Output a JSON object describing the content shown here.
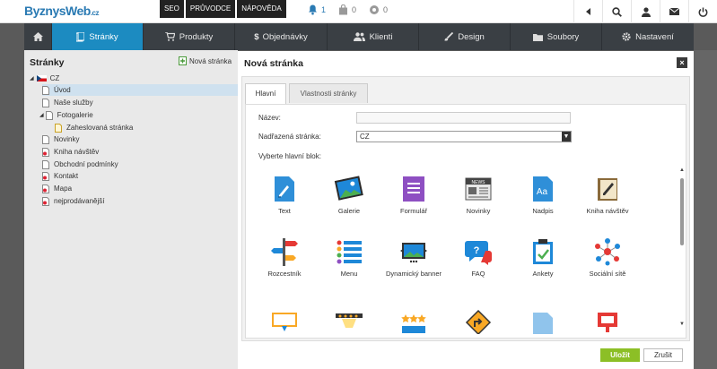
{
  "topbar": {
    "logo": "ByznysWeb",
    "logo_suffix": ".cz",
    "links": [
      "SEO",
      "PRŮVODCE",
      "NÁPOVĚDA"
    ],
    "counters": [
      {
        "icon": "bell-icon",
        "value": "1"
      },
      {
        "icon": "bag-icon",
        "value": "0"
      },
      {
        "icon": "gear-icon",
        "value": "0"
      }
    ],
    "right_icons": [
      "back-arrow-icon",
      "search-icon",
      "user-icon",
      "mail-icon",
      "power-icon"
    ]
  },
  "nav": {
    "items": [
      {
        "label": "",
        "icon": "home-icon"
      },
      {
        "label": "Stránky",
        "icon": "pages-icon",
        "active": true
      },
      {
        "label": "Produkty",
        "icon": "cart-icon"
      },
      {
        "label": "Objednávky",
        "icon": "dollar-icon"
      },
      {
        "label": "Klienti",
        "icon": "clients-icon"
      },
      {
        "label": "Design",
        "icon": "brush-icon"
      },
      {
        "label": "Soubory",
        "icon": "folder-icon"
      },
      {
        "label": "Nastavení",
        "icon": "gear-icon"
      }
    ]
  },
  "sidebar": {
    "title": "Stránky",
    "new_page": "Nová stránka",
    "root": "CZ",
    "items": [
      {
        "label": "Úvod",
        "selected": true
      },
      {
        "label": "Naše služby"
      },
      {
        "label": "Fotogalerie"
      },
      {
        "label": "Zaheslovaná stránka"
      },
      {
        "label": "Novinky"
      },
      {
        "label": "Kniha návštěv"
      },
      {
        "label": "Obchodní podmínky"
      },
      {
        "label": "Kontakt"
      },
      {
        "label": "Mapa"
      },
      {
        "label": "nejprodávanější"
      }
    ]
  },
  "modal": {
    "title": "Nová stránka",
    "close": "×",
    "tabs": [
      {
        "label": "Hlavní",
        "active": true
      },
      {
        "label": "Vlastnosti stránky"
      }
    ],
    "name_label": "Název:",
    "name_value": "",
    "parent_label": "Nadřazená stránka:",
    "parent_value": "CZ",
    "block_label": "Vyberte hlavní blok:",
    "blocks": [
      {
        "label": "Text",
        "icon": "text-icon"
      },
      {
        "label": "Galerie",
        "icon": "gallery-icon"
      },
      {
        "label": "Formulář",
        "icon": "form-icon"
      },
      {
        "label": "Novinky",
        "icon": "news-icon"
      },
      {
        "label": "Nadpis",
        "icon": "heading-icon"
      },
      {
        "label": "Kniha návštěv",
        "icon": "guestbook-icon"
      },
      {
        "label": "Rozcestník",
        "icon": "signpost-icon"
      },
      {
        "label": "Menu",
        "icon": "menu-icon"
      },
      {
        "label": "Dynamický banner",
        "icon": "banner-icon"
      },
      {
        "label": "FAQ",
        "icon": "faq-icon"
      },
      {
        "label": "Ankety",
        "icon": "poll-icon"
      },
      {
        "label": "Sociální sítě",
        "icon": "social-icon"
      }
    ],
    "save": "Uložit",
    "cancel": "Zrušit"
  }
}
